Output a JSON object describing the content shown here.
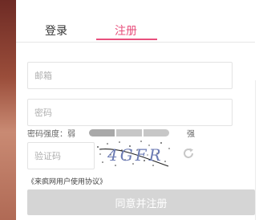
{
  "tabs": {
    "login_label": "登录",
    "register_label": "注册",
    "active": "register"
  },
  "form": {
    "email_placeholder": "邮箱",
    "password_placeholder": "密码",
    "captcha_placeholder": "验证码",
    "strength_label": "密码强度：弱",
    "strength_high_label": "强",
    "strength_level_segments_on": 1,
    "strength_total_segments": 3,
    "captcha_text": "4GFR",
    "refresh_icon": "refresh-icon",
    "agreement_label": "《来疯网用户使用协议》",
    "submit_label": "同意并注册"
  },
  "colors": {
    "accent": "#e8507d",
    "button_disabled": "#d5d5d5"
  }
}
